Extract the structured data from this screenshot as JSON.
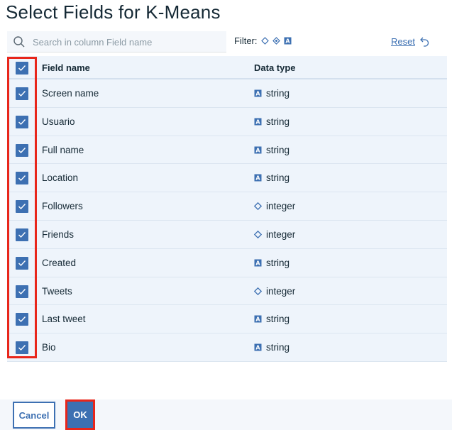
{
  "dialog": {
    "title": "Select Fields for K-Means"
  },
  "search": {
    "placeholder": "Search in column Field name"
  },
  "filter": {
    "label": "Filter:",
    "icons": [
      "diamond-icon",
      "diamond-dot-icon",
      "string-type-icon"
    ]
  },
  "reset": {
    "label": "Reset",
    "icon": "undo-icon"
  },
  "table": {
    "headers": {
      "field": "Field name",
      "type": "Data type"
    },
    "rows": [
      {
        "field": "Screen name",
        "type": "string",
        "icon": "string-type-icon",
        "checked": true
      },
      {
        "field": "Usuario",
        "type": "string",
        "icon": "string-type-icon",
        "checked": true
      },
      {
        "field": "Full name",
        "type": "string",
        "icon": "string-type-icon",
        "checked": true
      },
      {
        "field": "Location",
        "type": "string",
        "icon": "string-type-icon",
        "checked": true
      },
      {
        "field": "Followers",
        "type": "integer",
        "icon": "integer-type-icon",
        "checked": true
      },
      {
        "field": "Friends",
        "type": "integer",
        "icon": "integer-type-icon",
        "checked": true
      },
      {
        "field": "Created",
        "type": "string",
        "icon": "string-type-icon",
        "checked": true
      },
      {
        "field": "Tweets",
        "type": "integer",
        "icon": "integer-type-icon",
        "checked": true
      },
      {
        "field": "Last tweet",
        "type": "string",
        "icon": "string-type-icon",
        "checked": true
      },
      {
        "field": "Bio",
        "type": "string",
        "icon": "string-type-icon",
        "checked": true
      }
    ]
  },
  "buttons": {
    "cancel": "Cancel",
    "ok": "OK"
  },
  "colors": {
    "accent": "#3d70b2",
    "highlight": "#e8261b",
    "row_bg": "#eef4fb",
    "text": "#152935"
  }
}
